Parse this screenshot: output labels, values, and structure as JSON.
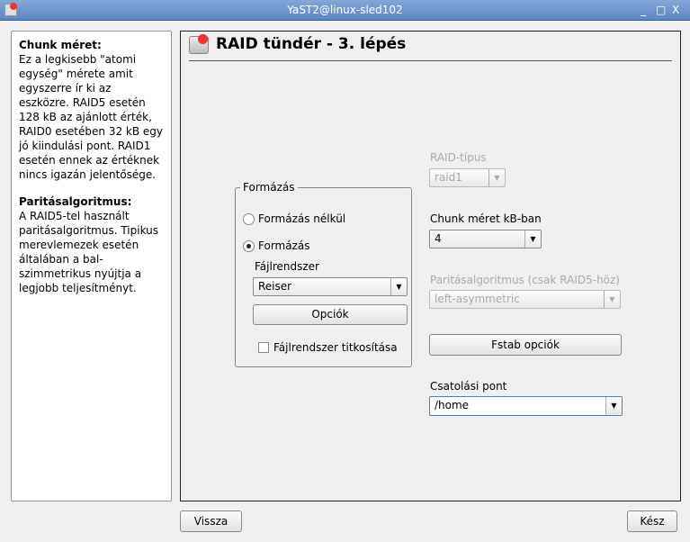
{
  "window": {
    "title": "YaST2@linux-sled102",
    "min": "_",
    "max": "□",
    "close": "X"
  },
  "help": {
    "sections": [
      {
        "heading": "Chunk méret:",
        "text": "Ez a legkisebb \"atomi egység\" mérete amit egyszerre ír ki az eszközre. RAID5 esetén 128 kB az ajánlott érték, RAID0 esetében 32 kB egy jó kiindulási pont. RAID1 esetén ennek az értéknek nincs igazán jelentősége."
      },
      {
        "heading": "Paritásalgoritmus:",
        "text": "A RAID5-tel használt paritásalgoritmus. Tipikus merevlemezek esetén általában a bal-szimmetrikus nyújtja a legjobb teljesítményt."
      }
    ]
  },
  "main": {
    "title": "RAID tündér - 3. lépés",
    "format_frame": {
      "title": "Formázás",
      "no_format": "Formázás nélkül",
      "format": "Formázás",
      "selected": "format",
      "fs_label": "Fájlrendszer",
      "fs_value": "Reiser",
      "options_button": "Opciók",
      "encrypt_label": "Fájlrendszer titkosítása",
      "encrypt_checked": false
    },
    "raid_type": {
      "label": "RAID-típus",
      "value": "raid1"
    },
    "chunk": {
      "label": "Chunk méret kB-ban",
      "value": "4"
    },
    "parity": {
      "label": "Paritásalgoritmus (csak RAID5-höz)",
      "value": "left-asymmetric"
    },
    "fstab_button": "Fstab opciók",
    "mount": {
      "label": "Csatolási pont",
      "value": "/home"
    }
  },
  "footer": {
    "back": "Vissza",
    "finish": "Kész"
  }
}
